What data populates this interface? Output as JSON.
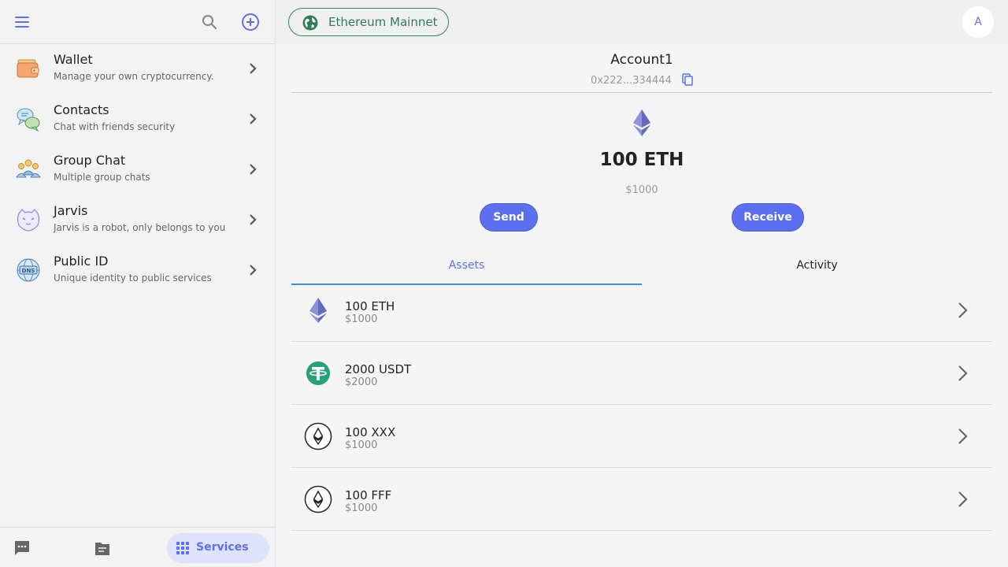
{
  "sidebar": {
    "services": [
      {
        "title": "Wallet",
        "description": "Manage your own cryptocurrency.",
        "icon": "wallet-icon"
      },
      {
        "title": "Contacts",
        "description": "Chat with friends security",
        "icon": "contacts-icon"
      },
      {
        "title": "Group Chat",
        "description": "Multiple group chats",
        "icon": "group-chat-icon"
      },
      {
        "title": "Jarvis",
        "description": "Jarvis is a robot, only belongs to you",
        "icon": "jarvis-icon"
      },
      {
        "title": "Public ID",
        "description": "Unique identity to public services",
        "icon": "dns-icon"
      }
    ],
    "bottom_nav": {
      "services_label": "Services"
    }
  },
  "topbar": {
    "network_label": "Ethereum Mainnet",
    "avatar_initial": "A"
  },
  "account": {
    "name": "Account1",
    "address": "0x222...334444",
    "balance": "100 ETH",
    "balance_fiat": "$1000"
  },
  "actions": {
    "send_label": "Send",
    "receive_label": "Receive"
  },
  "tabs": [
    {
      "label": "Assets",
      "active": true
    },
    {
      "label": "Activity",
      "active": false
    }
  ],
  "assets": [
    {
      "amount": "100 ETH",
      "fiat": "$1000",
      "icon": "eth-icon"
    },
    {
      "amount": "2000 USDT",
      "fiat": "$2000",
      "icon": "usdt-icon"
    },
    {
      "amount": "100 XXX",
      "fiat": "$1000",
      "icon": "token-icon"
    },
    {
      "amount": "100 FFF",
      "fiat": "$1000",
      "icon": "token-icon"
    }
  ],
  "colors": {
    "accent": "#5b6ff0",
    "network_green": "#2e8b57",
    "tab_underline": "#3d8fe0",
    "usdt_teal": "#26a17b"
  }
}
